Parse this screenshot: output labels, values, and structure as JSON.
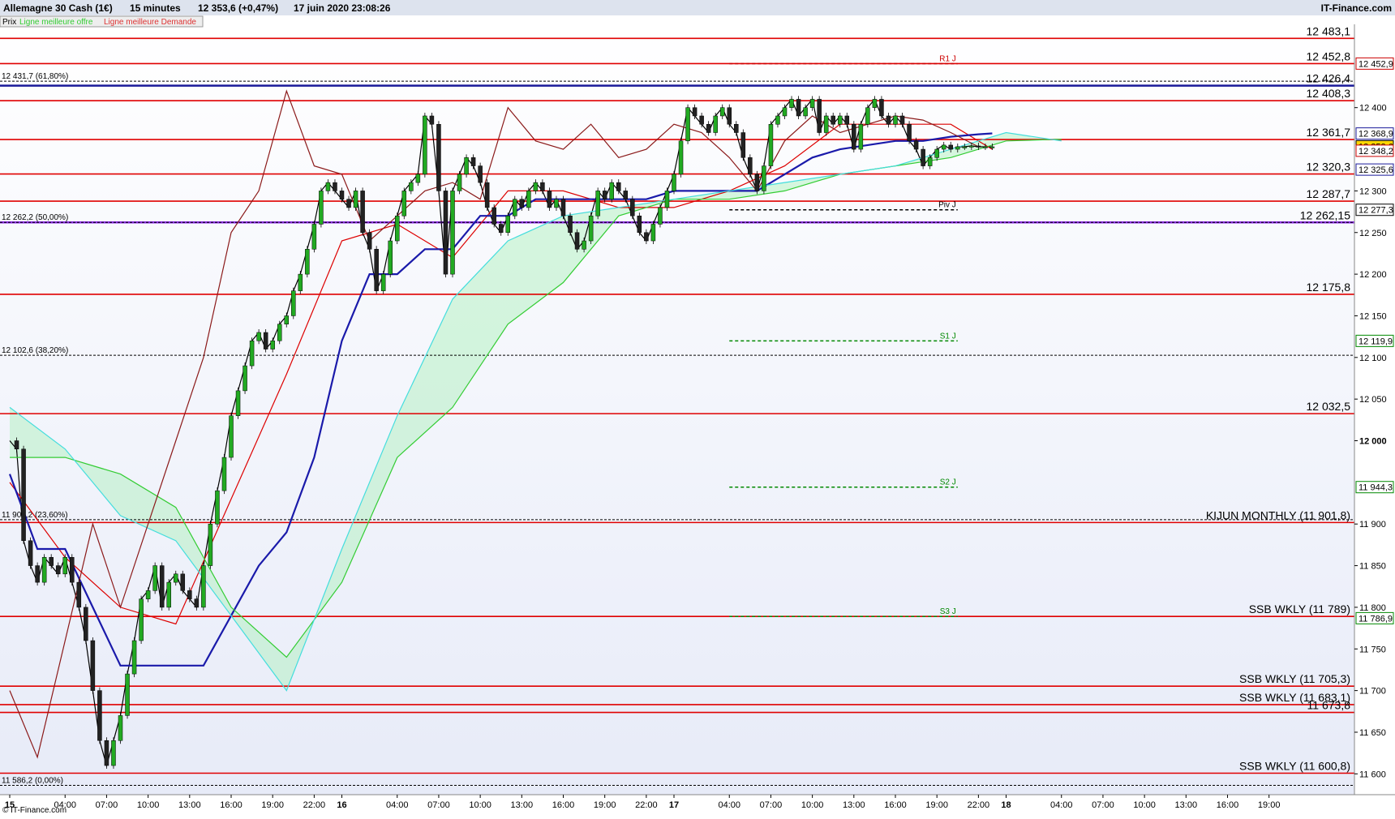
{
  "header": {
    "instrument": "Allemagne 30 Cash (1€)",
    "timeframe": "15 minutes",
    "price_change": "12 353,6 (+0,47%)",
    "datetime": "17 juin 2020 23:08:26",
    "brand": "IT-Finance.com",
    "legend_prix": "Prix",
    "legend_offre": "Ligne meilleure offre",
    "legend_demande": "Ligne meilleure Demande",
    "footer_brand": "© IT-Finance.com"
  },
  "chart_data": {
    "type": "line",
    "title": "Allemagne 30 Cash (1€)",
    "ylim": [
      11575,
      12500
    ],
    "grid": false,
    "y_ticks": [
      {
        "value": 12400,
        "label": "12 400"
      },
      {
        "value": 12300,
        "label": "12 300"
      },
      {
        "value": 12250,
        "label": "12 250"
      },
      {
        "value": 12200,
        "label": "12 200"
      },
      {
        "value": 12150,
        "label": "12 150"
      },
      {
        "value": 12100,
        "label": "12 100"
      },
      {
        "value": 12050,
        "label": "12 050"
      },
      {
        "value": 12000,
        "label": "12 000",
        "bold": true
      },
      {
        "value": 11900,
        "label": "11 900"
      },
      {
        "value": 11850,
        "label": "11 850"
      },
      {
        "value": 11800,
        "label": "11 800"
      },
      {
        "value": 11750,
        "label": "11 750"
      },
      {
        "value": 11700,
        "label": "11 700"
      },
      {
        "value": 11650,
        "label": "11 650"
      },
      {
        "value": 11600,
        "label": "11 600"
      }
    ],
    "x_ticks": [
      {
        "t": 0,
        "label": "15",
        "bold": true
      },
      {
        "t": 4,
        "label": "04:00"
      },
      {
        "t": 7,
        "label": "07:00"
      },
      {
        "t": 10,
        "label": "10:00"
      },
      {
        "t": 13,
        "label": "13:00"
      },
      {
        "t": 16,
        "label": "16:00"
      },
      {
        "t": 19,
        "label": "19:00"
      },
      {
        "t": 22,
        "label": "22:00"
      },
      {
        "t": 24,
        "label": "16",
        "bold": true
      },
      {
        "t": 28,
        "label": "04:00"
      },
      {
        "t": 31,
        "label": "07:00"
      },
      {
        "t": 34,
        "label": "10:00"
      },
      {
        "t": 37,
        "label": "13:00"
      },
      {
        "t": 40,
        "label": "16:00"
      },
      {
        "t": 43,
        "label": "19:00"
      },
      {
        "t": 46,
        "label": "22:00"
      },
      {
        "t": 48,
        "label": "17",
        "bold": true
      },
      {
        "t": 52,
        "label": "04:00"
      },
      {
        "t": 55,
        "label": "07:00"
      },
      {
        "t": 58,
        "label": "10:00"
      },
      {
        "t": 61,
        "label": "13:00"
      },
      {
        "t": 64,
        "label": "16:00"
      },
      {
        "t": 67,
        "label": "19:00"
      },
      {
        "t": 70,
        "label": "22:00"
      },
      {
        "t": 72,
        "label": "18",
        "bold": true
      },
      {
        "t": 76,
        "label": "04:00"
      },
      {
        "t": 79,
        "label": "07:00"
      },
      {
        "t": 82,
        "label": "10:00"
      },
      {
        "t": 85,
        "label": "13:00"
      },
      {
        "t": 88,
        "label": "16:00"
      },
      {
        "t": 91,
        "label": "19:00"
      }
    ],
    "horizontal_levels": [
      {
        "value": 12483.1,
        "label": "12 483,1",
        "color": "#e00000",
        "style": "solid"
      },
      {
        "value": 12452.8,
        "label": "12 452,8",
        "color": "#e00000",
        "style": "solid"
      },
      {
        "value": 12426.4,
        "label": "12 426,4",
        "color": "#1a1a9a",
        "style": "solid"
      },
      {
        "value": 12408.3,
        "label": "12 408,3",
        "color": "#e00000",
        "style": "solid"
      },
      {
        "value": 12361.7,
        "label": "12 361,7",
        "color": "#e00000",
        "style": "solid"
      },
      {
        "value": 12320.3,
        "label": "12 320,3",
        "color": "#e00000",
        "style": "solid"
      },
      {
        "value": 12287.7,
        "label": "12 287,7",
        "color": "#e00000",
        "style": "solid"
      },
      {
        "value": 12262.15,
        "label": "12 262,15",
        "color": "#8a2be2",
        "style": "solid"
      },
      {
        "value": 12175.8,
        "label": "12 175,8",
        "color": "#e00000",
        "style": "solid"
      },
      {
        "value": 12032.5,
        "label": "12 032,5",
        "color": "#e00000",
        "style": "solid"
      },
      {
        "value": 11901.8,
        "label": "KIJUN MONTHLY (11 901,8)",
        "color": "#e00000",
        "style": "solid"
      },
      {
        "value": 11789,
        "label": "SSB WKLY (11 789)",
        "color": "#e00000",
        "style": "solid"
      },
      {
        "value": 11705.3,
        "label": "SSB WKLY (11 705,3)",
        "color": "#e00000",
        "style": "solid"
      },
      {
        "value": 11683.1,
        "label": "SSB WKLY (11 683,1)",
        "color": "#e00000",
        "style": "solid"
      },
      {
        "value": 11673.8,
        "label": "11 673,8",
        "color": "#e00000",
        "style": "solid"
      },
      {
        "value": 11600.8,
        "label": "SSB WKLY (11 600,8)",
        "color": "#e00000",
        "style": "solid"
      }
    ],
    "fibonacci": [
      {
        "value": 12431.7,
        "label": "12 431,7 (61,80%)"
      },
      {
        "value": 12262.2,
        "label": "12 262,2 (50,00%)"
      },
      {
        "value": 12102.6,
        "label": "12 102,6 (38,20%)"
      },
      {
        "value": 11905.2,
        "label": "11 905,2 (23,60%)"
      },
      {
        "value": 11586.2,
        "label": "11 586,2 (0,00%)"
      }
    ],
    "pivots": [
      {
        "value": 12452.8,
        "label": "R1 J",
        "color": "#cc0000"
      },
      {
        "value": 12277.3,
        "label": "Piv J",
        "color": "#000000"
      },
      {
        "value": 12119.9,
        "label": "S1 J",
        "color": "#008800"
      },
      {
        "value": 11944.3,
        "label": "S2 J",
        "color": "#008800"
      },
      {
        "value": 11789,
        "label": "S3 J",
        "color": "#008800"
      }
    ],
    "price_tags": [
      {
        "value": 12452.9,
        "label": "12 452,9",
        "color": "#cc0000"
      },
      {
        "value": 12368.9,
        "label": "12 368,9",
        "color": "#1a1a9a"
      },
      {
        "value": 12353.6,
        "label": "12 353,6",
        "color": "#000000",
        "bg": "#ffd700"
      },
      {
        "value": 12348.2,
        "label": "12 348,2",
        "color": "#cc0000"
      },
      {
        "value": 12325.6,
        "label": "12 325,6",
        "color": "#1a1a9a"
      },
      {
        "value": 12277.3,
        "label": "12 277,3",
        "color": "#000000"
      },
      {
        "value": 12119.9,
        "label": "12 119,9",
        "color": "#008800"
      },
      {
        "value": 11944.3,
        "label": "11 944,3",
        "color": "#008800"
      },
      {
        "value": 11786.9,
        "label": "11 786,9",
        "color": "#008800"
      }
    ],
    "series": [
      {
        "name": "close",
        "color": "#000000",
        "t": [
          0,
          0.5,
          1,
          1.5,
          2,
          2.5,
          3,
          3.5,
          4,
          4.5,
          5,
          5.5,
          6,
          6.5,
          7,
          7.5,
          8,
          8.5,
          9,
          9.5,
          10,
          10.5,
          11,
          11.5,
          12,
          12.5,
          13,
          13.5,
          14,
          14.5,
          15,
          15.5,
          16,
          16.5,
          17,
          17.5,
          18,
          18.5,
          19,
          19.5,
          20,
          20.5,
          21,
          21.5,
          22,
          22.5,
          23,
          23.5,
          24,
          24.5,
          25,
          25.5,
          26,
          26.5,
          27,
          27.5,
          28,
          28.5,
          29,
          29.5,
          30,
          30.5,
          31,
          31.5,
          32,
          32.5,
          33,
          33.5,
          34,
          34.5,
          35,
          35.5,
          36,
          36.5,
          37,
          37.5,
          38,
          38.5,
          39,
          39.5,
          40,
          40.5,
          41,
          41.5,
          42,
          42.5,
          43,
          43.5,
          44,
          44.5,
          45,
          45.5,
          46,
          46.5,
          47,
          47.5,
          48,
          48.5,
          49,
          49.5,
          50,
          50.5,
          51,
          51.5,
          52,
          52.5,
          53,
          53.5,
          54,
          54.5,
          55,
          55.5,
          56,
          56.5,
          57,
          57.5,
          58,
          58.5,
          59,
          59.5,
          60,
          60.5,
          61,
          61.5,
          62,
          62.5,
          63,
          63.5,
          64,
          64.5,
          65,
          65.5,
          66,
          66.5,
          67,
          67.5,
          68,
          68.5,
          69,
          69.5,
          70,
          70.5,
          71
        ],
        "values": [
          12000,
          11990,
          11880,
          11850,
          11830,
          11860,
          11850,
          11840,
          11860,
          11830,
          11800,
          11760,
          11700,
          11640,
          11610,
          11640,
          11670,
          11720,
          11760,
          11810,
          11820,
          11850,
          11800,
          11830,
          11840,
          11820,
          11810,
          11800,
          11850,
          11900,
          11940,
          11980,
          12030,
          12060,
          12090,
          12120,
          12130,
          12110,
          12120,
          12140,
          12150,
          12180,
          12200,
          12230,
          12260,
          12300,
          12310,
          12300,
          12290,
          12280,
          12300,
          12250,
          12230,
          12180,
          12200,
          12240,
          12270,
          12300,
          12310,
          12320,
          12390,
          12380,
          12300,
          12200,
          12300,
          12320,
          12340,
          12330,
          12310,
          12280,
          12260,
          12250,
          12270,
          12290,
          12280,
          12300,
          12310,
          12300,
          12280,
          12290,
          12270,
          12250,
          12230,
          12240,
          12270,
          12300,
          12290,
          12310,
          12300,
          12290,
          12270,
          12250,
          12240,
          12260,
          12280,
          12300,
          12320,
          12360,
          12400,
          12390,
          12380,
          12370,
          12390,
          12400,
          12380,
          12370,
          12340,
          12320,
          12300,
          12330,
          12380,
          12390,
          12400,
          12410,
          12390,
          12400,
          12410,
          12370,
          12390,
          12380,
          12390,
          12380,
          12350,
          12380,
          12400,
          12410,
          12390,
          12380,
          12390,
          12380,
          12360,
          12350,
          12330,
          12340,
          12350,
          12355,
          12350,
          12353,
          12353,
          12354,
          12353,
          12353,
          12353
        ]
      },
      {
        "name": "tenkan",
        "color": "#dd0000",
        "t": [
          0,
          4,
          8,
          12,
          16,
          20,
          24,
          28,
          32,
          36,
          40,
          44,
          48,
          52,
          56,
          60,
          64,
          68,
          71
        ],
        "values": [
          11950,
          11860,
          11800,
          11780,
          11930,
          12080,
          12240,
          12260,
          12220,
          12300,
          12300,
          12280,
          12280,
          12300,
          12330,
          12380,
          12380,
          12380,
          12350
        ]
      },
      {
        "name": "kijun",
        "color": "#1a1aaa",
        "t": [
          0,
          2,
          4,
          6,
          8,
          10,
          12,
          14,
          16,
          18,
          20,
          22,
          24,
          26,
          28,
          30,
          32,
          34,
          36,
          38,
          40,
          42,
          44,
          46,
          48,
          50,
          52,
          54,
          56,
          58,
          60,
          62,
          64,
          66,
          68,
          70,
          71
        ],
        "values": [
          11960,
          11870,
          11870,
          11800,
          11730,
          11730,
          11730,
          11730,
          11790,
          11850,
          11890,
          11980,
          12120,
          12200,
          12200,
          12230,
          12230,
          12270,
          12270,
          12290,
          12290,
          12290,
          12290,
          12290,
          12300,
          12300,
          12300,
          12300,
          12320,
          12340,
          12350,
          12355,
          12360,
          12360,
          12365,
          12368,
          12369
        ]
      },
      {
        "name": "ssa",
        "color": "#33cc33",
        "t": [
          0,
          4,
          8,
          12,
          16,
          20,
          24,
          28,
          32,
          36,
          40,
          44,
          48,
          52,
          56,
          60,
          64,
          68,
          72,
          76
        ],
        "values": [
          11980,
          11980,
          11960,
          11920,
          11800,
          11740,
          11830,
          11980,
          12040,
          12140,
          12190,
          12270,
          12290,
          12290,
          12300,
          12320,
          12330,
          12340,
          12360,
          12362
        ]
      },
      {
        "name": "ssb",
        "color": "#44dddd",
        "t": [
          0,
          4,
          8,
          12,
          16,
          20,
          24,
          28,
          32,
          36,
          40,
          44,
          48,
          52,
          56,
          60,
          64,
          68,
          72,
          76
        ],
        "values": [
          12040,
          11990,
          11910,
          11880,
          11790,
          11700,
          11870,
          12030,
          12170,
          12240,
          12270,
          12280,
          12290,
          12300,
          12310,
          12320,
          12330,
          12350,
          12370,
          12360
        ]
      },
      {
        "name": "chikou",
        "color": "#8b1a1a",
        "t": [
          0,
          2,
          4,
          6,
          8,
          10,
          12,
          14,
          16,
          18,
          20,
          22,
          24,
          26,
          28,
          30,
          32,
          34,
          36,
          38,
          40,
          42,
          44,
          46,
          48,
          50,
          52,
          54,
          56,
          58,
          60,
          62,
          64,
          66,
          68,
          70
        ],
        "values": [
          11700,
          11620,
          11760,
          11900,
          11800,
          11900,
          12000,
          12100,
          12250,
          12300,
          12420,
          12330,
          12320,
          12240,
          12270,
          12300,
          12310,
          12290,
          12400,
          12360,
          12350,
          12380,
          12340,
          12350,
          12380,
          12370,
          12340,
          12300,
          12360,
          12390,
          12370,
          12380,
          12390,
          12385,
          12370,
          12353
        ]
      }
    ]
  }
}
